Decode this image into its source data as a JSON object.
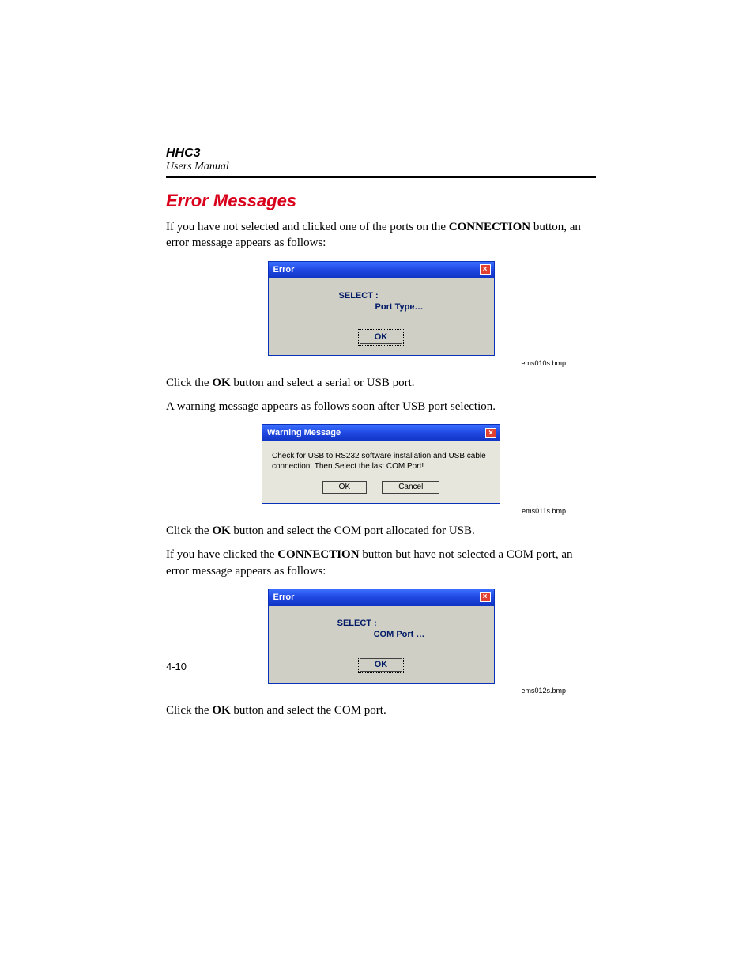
{
  "header": {
    "product": "HHC3",
    "doc": "Users Manual"
  },
  "section_title": "Error Messages",
  "para1_a": "If you have not selected and clicked one of the ports on the ",
  "para1_bold": "CONNECTION",
  "para1_b": " button, an error message appears as follows:",
  "dialog1": {
    "title": "Error",
    "close": "×",
    "select": "SELECT :",
    "port": "Port Type…",
    "ok": "OK"
  },
  "cap1": "ems010s.bmp",
  "para2_a": "Click the ",
  "para2_bold": "OK",
  "para2_b": " button and select a serial or USB port.",
  "para3": "A warning message appears as follows soon after USB port selection.",
  "dialog2": {
    "title": "Warning Message",
    "close": "×",
    "msg": "Check for USB to RS232 software installation and USB cable connection. Then Select the last COM Port!",
    "ok": "OK",
    "cancel": "Cancel"
  },
  "cap2": "ems011s.bmp",
  "para4_a": "Click the ",
  "para4_bold": "OK",
  "para4_b": " button and select the COM port allocated for USB.",
  "para5_a": "If you have clicked the ",
  "para5_bold": "CONNECTION",
  "para5_b": " button but have not selected a COM port, an error message appears as follows:",
  "dialog3": {
    "title": "Error",
    "close": "×",
    "select": "SELECT :",
    "port": "COM Port …",
    "ok": "OK"
  },
  "cap3": "ems012s.bmp",
  "para6_a": "Click the ",
  "para6_bold": "OK",
  "para6_b": " button and select the COM port.",
  "page_number": "4-10"
}
